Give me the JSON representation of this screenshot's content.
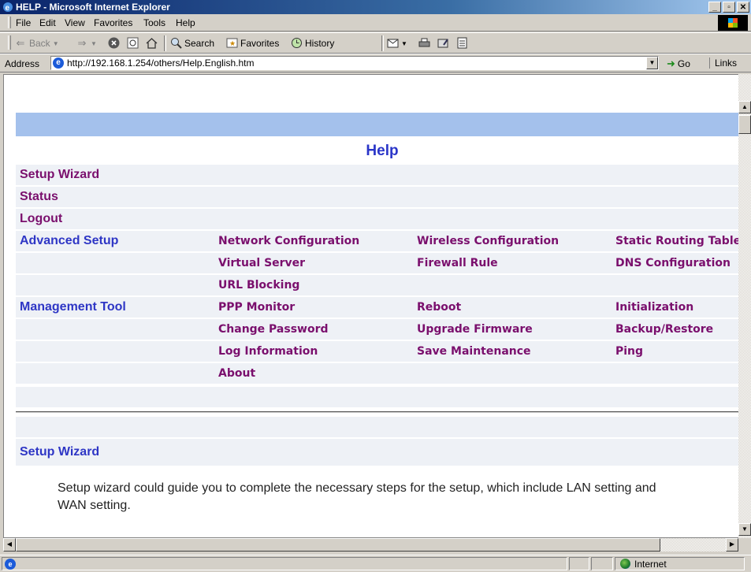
{
  "window": {
    "title": "HELP - Microsoft Internet Explorer",
    "controls": [
      "_",
      "8",
      "x"
    ]
  },
  "menubar": {
    "items": [
      "File",
      "Edit",
      "View",
      "Favorites",
      "Tools",
      "Help"
    ]
  },
  "toolbar": {
    "back": "Back",
    "search": "Search",
    "favorites": "Favorites",
    "history": "History"
  },
  "address": {
    "label": "Address",
    "url": "http://192.168.1.254/others/Help.English.htm",
    "go": "Go",
    "links": "Links"
  },
  "page": {
    "title": "Help",
    "sections": {
      "setup_wizard": "Setup Wizard",
      "status": "Status",
      "logout": "Logout",
      "advanced_setup": "Advanced Setup",
      "management_tool": "Management Tool"
    },
    "advanced_links": [
      [
        "Network Configuration",
        "Wireless Configuration",
        "Static Routing Table"
      ],
      [
        "Virtual Server",
        "Firewall Rule",
        "DNS Configuration"
      ],
      [
        "URL Blocking",
        "",
        ""
      ]
    ],
    "management_links": [
      [
        "PPP Monitor",
        "Reboot",
        "Initialization"
      ],
      [
        "Change Password",
        "Upgrade Firmware",
        "Backup/Restore"
      ],
      [
        "Log Information",
        "Save Maintenance",
        "Ping"
      ],
      [
        "About",
        "",
        ""
      ]
    ],
    "setup_wizard_heading": "Setup Wizard",
    "setup_wizard_desc_line1": "Setup wizard could guide you to complete the necessary steps for the setup, which include LAN setting and",
    "setup_wizard_desc_line2": "WAN setting."
  },
  "statusbar": {
    "zone": "Internet"
  },
  "colors": {
    "blue_bar": "#a4c1ec",
    "row_bg": "#eef1f6",
    "link_purple": "#7a0f6d",
    "heading_blue": "#2e36c5"
  }
}
